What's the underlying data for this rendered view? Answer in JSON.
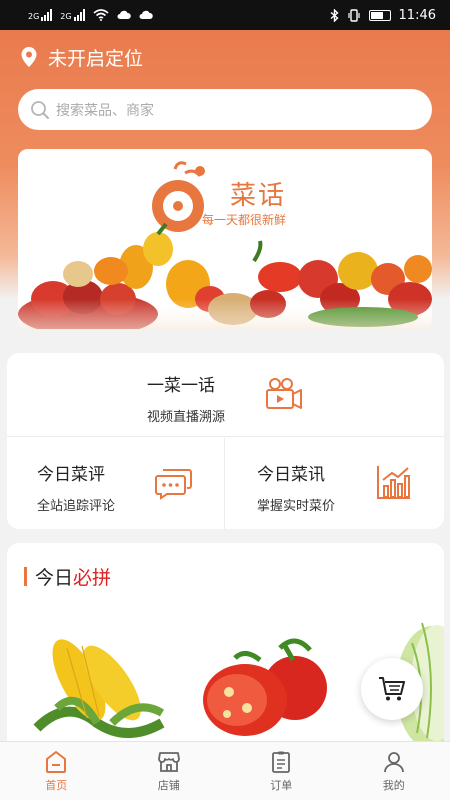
{
  "statusbar": {
    "network_left": "2G",
    "network_right": "2G",
    "time": "11:46"
  },
  "location": {
    "text": "未开启定位"
  },
  "search": {
    "placeholder": "搜索菜品、商家"
  },
  "banner": {
    "brand": "菜话",
    "slogan": "每一天都很新鲜"
  },
  "features": {
    "top": {
      "title": "一菜一话",
      "subtitle": "视频直播溯源"
    },
    "left": {
      "title": "今日菜评",
      "subtitle": "全站追踪评论"
    },
    "right": {
      "title": "今日菜讯",
      "subtitle": "掌握实时菜价"
    }
  },
  "section": {
    "title_plain": "今日",
    "title_highlight": "必拼"
  },
  "tabs": [
    {
      "label": "首页",
      "icon": "home-icon",
      "active": true
    },
    {
      "label": "店铺",
      "icon": "store-icon",
      "active": false
    },
    {
      "label": "订单",
      "icon": "clipboard-icon",
      "active": false
    },
    {
      "label": "我的",
      "icon": "user-icon",
      "active": false
    }
  ],
  "colors": {
    "accent": "#e8773f",
    "highlight": "#e02020"
  }
}
